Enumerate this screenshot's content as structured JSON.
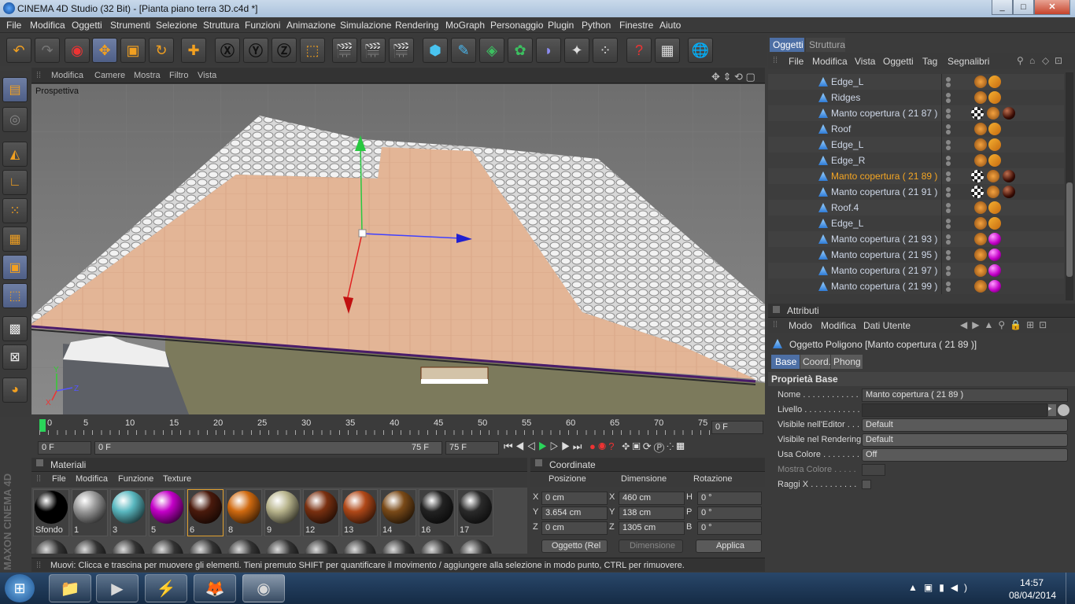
{
  "window": {
    "title": "CINEMA 4D Studio (32 Bit) - [Pianta piano terra 3D.c4d *]",
    "min": "_",
    "max": "□",
    "close": "✕"
  },
  "menu": [
    "File",
    "Modifica",
    "Oggetti",
    "Strumenti",
    "Selezione",
    "Struttura",
    "Funzioni",
    "Animazione",
    "Simulazione",
    "Rendering",
    "MoGraph",
    "Personaggio",
    "Plugin",
    "Python",
    "Finestre",
    "Aiuto"
  ],
  "viewport": {
    "menu": [
      "Modifica",
      "Camere",
      "Mostra",
      "Filtro",
      "Vista"
    ],
    "label": "Prospettiva"
  },
  "timeline": {
    "ticks": [
      "0",
      "5",
      "10",
      "15",
      "20",
      "25",
      "30",
      "35",
      "40",
      "45",
      "50",
      "55",
      "60",
      "65",
      "70",
      "75"
    ],
    "current": "0 F",
    "start": "0 F",
    "range_start": "0 F",
    "range_end": "75 F",
    "end": "75 F"
  },
  "materials": {
    "title": "Materiali",
    "menu": [
      "File",
      "Modifica",
      "Funzione",
      "Texture"
    ],
    "items": [
      {
        "label": "Sfondo",
        "color": "#000000"
      },
      {
        "label": "1",
        "color": "#9a9a9a"
      },
      {
        "label": "3",
        "color": "#5ab8c0"
      },
      {
        "label": "5",
        "color": "#c400c8"
      },
      {
        "label": "6",
        "color": "#4a1a0c"
      },
      {
        "label": "8",
        "color": "#d06a10"
      },
      {
        "label": "9",
        "color": "#b8b48c"
      },
      {
        "label": "12",
        "color": "#7a3010"
      },
      {
        "label": "13",
        "color": "#b04818"
      },
      {
        "label": "14",
        "color": "#7a4a18"
      },
      {
        "label": "16",
        "color": "#222222"
      },
      {
        "label": "17",
        "color": "#2a2a2a"
      }
    ]
  },
  "coords": {
    "title": "Coordinate",
    "headers": [
      "Posizione",
      "Dimensione",
      "Rotazione"
    ],
    "rows": [
      {
        "axis": "X",
        "pos": "0 cm",
        "dimaxis": "X",
        "dim": "460 cm",
        "rotaxis": "H",
        "rot": "0 °"
      },
      {
        "axis": "Y",
        "pos": "3.654 cm",
        "dimaxis": "Y",
        "dim": "138 cm",
        "rotaxis": "P",
        "rot": "0 °"
      },
      {
        "axis": "Z",
        "pos": "0 cm",
        "dimaxis": "Z",
        "dim": "1305 cm",
        "rotaxis": "B",
        "rot": "0 °"
      }
    ],
    "mode": "Oggetto (Rel",
    "mode2": "Dimensione",
    "apply": "Applica"
  },
  "status": "Muovi: Clicca e trascina per muovere gli elementi. Tieni premuto SHIFT per quantificare il movimento / aggiungere alla selezione in modo punto, CTRL per rimuovere.",
  "objects": {
    "tabs": [
      "Oggetti",
      "Struttura"
    ],
    "menu": [
      "File",
      "Modifica",
      "Vista",
      "Oggetti",
      "Tag",
      "Segnalibri"
    ],
    "rows": [
      {
        "name": "Edge_L",
        "sel": false,
        "tags": "plain"
      },
      {
        "name": "Ridges",
        "sel": false,
        "tags": "plain"
      },
      {
        "name": "Manto copertura ( 21 87 )",
        "sel": false,
        "tags": "brown"
      },
      {
        "name": "Roof",
        "sel": false,
        "tags": "plain"
      },
      {
        "name": "Edge_L",
        "sel": false,
        "tags": "plain"
      },
      {
        "name": "Edge_R",
        "sel": false,
        "tags": "plain"
      },
      {
        "name": "Manto copertura ( 21 89 )",
        "sel": true,
        "tags": "brown"
      },
      {
        "name": "Manto copertura ( 21 91 )",
        "sel": false,
        "tags": "brown"
      },
      {
        "name": "Roof.4",
        "sel": false,
        "tags": "plain"
      },
      {
        "name": "Edge_L",
        "sel": false,
        "tags": "plain"
      },
      {
        "name": "Manto copertura ( 21 93 )",
        "sel": false,
        "tags": "purple"
      },
      {
        "name": "Manto copertura ( 21 95 )",
        "sel": false,
        "tags": "purple"
      },
      {
        "name": "Manto copertura ( 21 97 )",
        "sel": false,
        "tags": "purple"
      },
      {
        "name": "Manto copertura ( 21 99 )",
        "sel": false,
        "tags": "purple"
      }
    ]
  },
  "attributes": {
    "title": "Attributi",
    "menu": [
      "Modo",
      "Modifica",
      "Dati Utente"
    ],
    "object_title": "Oggetto Poligono [Manto copertura ( 21 89 )]",
    "tabs": [
      "Base",
      "Coord.",
      "Phong"
    ],
    "section": "Proprietà Base",
    "fields": [
      {
        "label": "Nome . . . . . . . . . . . .",
        "value": "Manto copertura ( 21 89 )"
      },
      {
        "label": "Livello . . . . . . . . . . . .",
        "value": ""
      },
      {
        "label": "Visibile nell'Editor . . .",
        "value": "Default"
      },
      {
        "label": "Visibile nel Rendering",
        "value": "Default"
      },
      {
        "label": "Usa Colore . . . . . . . .",
        "value": "Off"
      },
      {
        "label": "Mostra Colore . . . . .",
        "value": ""
      },
      {
        "label": "Raggi X . . . . . . . . . .",
        "value": ""
      }
    ]
  },
  "side_brand": "MAXON CINEMA 4D",
  "clock": {
    "time": "14:57",
    "date": "08/04/2014"
  }
}
